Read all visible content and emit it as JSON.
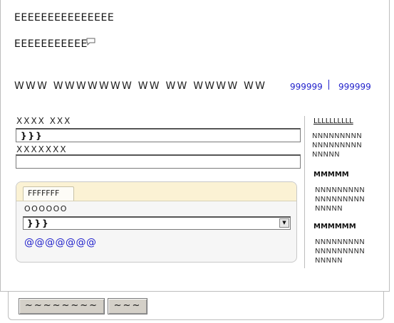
{
  "header": {
    "title": "EEEEEEEEEEEEEEE",
    "subtitle": "EEEEEEEEEEE"
  },
  "subheader": {
    "text": "WWW WWWWWWW WW  WW WWWW WW",
    "link_left": "999999",
    "link_right": "999999"
  },
  "form": {
    "field1_label": "XXXX XXX",
    "field1_value": "}}}",
    "field2_label": "XXXXXXX",
    "field2_value": ""
  },
  "group": {
    "tab_label": "FFFFFFF",
    "select_label": "OOOOOO",
    "select_value": "}}}",
    "link": "@@@@@@@"
  },
  "sidebar": {
    "section1_title": "LLLLLLLLLL",
    "section1_lines": [
      "NNNNNNNNN",
      "NNNNNNNNN",
      "NNNNN"
    ],
    "section2_title": "MMMMM",
    "section2_lines": [
      "NNNNNNNNN",
      "NNNNNNNNN",
      "NNNNN"
    ],
    "section3_title": "MMMMMM",
    "section3_lines": [
      "NNNNNNNNN",
      "NNNNNNNNN",
      "NNNNN"
    ]
  },
  "footer": {
    "primary_button": "~~~~~~~~",
    "secondary_button": "~~~"
  },
  "icons": {
    "comment": "comment-icon",
    "dropdown": "chevron-down-icon"
  },
  "colors": {
    "link": "#2222cc",
    "group_header": "#fbf2d4",
    "button_face": "#d4d0c8"
  }
}
